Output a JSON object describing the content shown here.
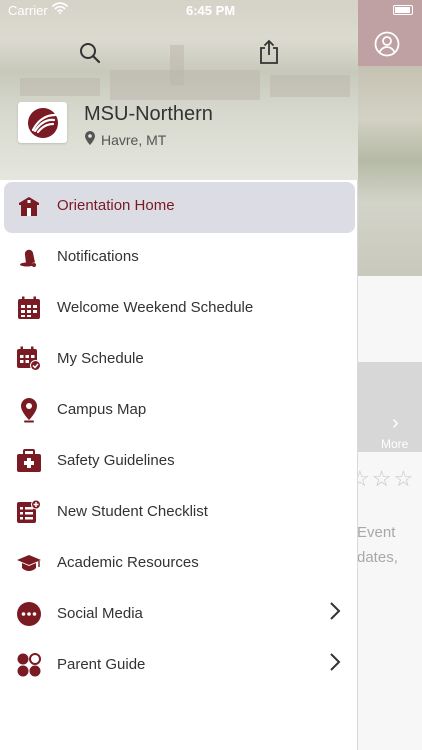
{
  "status": {
    "carrier": "Carrier",
    "time": "6:45 PM"
  },
  "app": {
    "title": "MSU-Northern",
    "location": "Havre, MT"
  },
  "colors": {
    "accent": "#7a1a23",
    "active_bg": "#dcdce4"
  },
  "menu": [
    {
      "label": "Orientation Home",
      "icon": "school-house-icon",
      "active": true
    },
    {
      "label": "Notifications",
      "icon": "bell-icon"
    },
    {
      "label": "Welcome Weekend Schedule",
      "icon": "calendar-grid-icon"
    },
    {
      "label": "My Schedule",
      "icon": "calendar-check-icon"
    },
    {
      "label": "Campus Map",
      "icon": "map-pin-icon"
    },
    {
      "label": "Safety Guidelines",
      "icon": "first-aid-kit-icon"
    },
    {
      "label": "New Student Checklist",
      "icon": "checklist-icon"
    },
    {
      "label": "Academic Resources",
      "icon": "graduation-cap-icon"
    },
    {
      "label": "Social Media",
      "icon": "ellipsis-circle-icon",
      "has_submenu": true
    },
    {
      "label": "Parent Guide",
      "icon": "four-circles-icon",
      "has_submenu": true
    }
  ],
  "background": {
    "card_more": "More",
    "text_lines": [
      "Event",
      "dates,"
    ]
  }
}
